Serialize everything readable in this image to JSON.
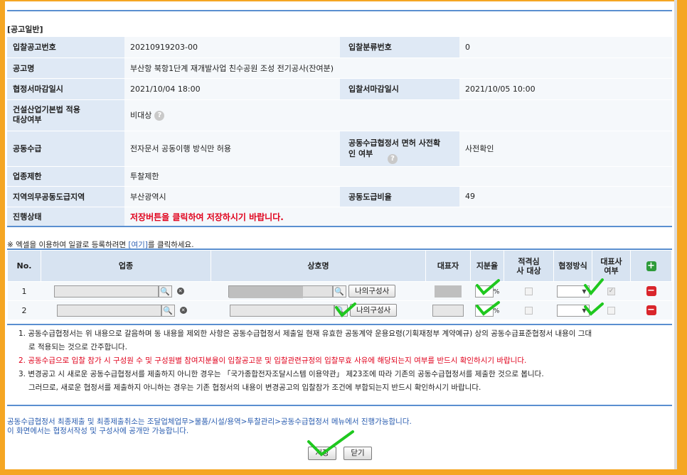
{
  "section_title": "[공고일반]",
  "info": {
    "bid_no_label": "입찰공고번호",
    "bid_no": "20210919203-00",
    "bid_class_label": "입찰분류번호",
    "bid_class": "0",
    "notice_name_label": "공고명",
    "notice_name": "부산항 북항1단계 재개발사업 친수공원 조성 전기공사(잔여분)",
    "agreement_deadline_label": "협정서마감일시",
    "agreement_deadline": "2021/10/04 18:00",
    "bid_deadline_label": "입찰서마감일시",
    "bid_deadline": "2021/10/05 10:00",
    "construction_law_label": "건설산업기본법 적용대상여부",
    "construction_law": "비대상",
    "joint_label": "공동수급",
    "joint": "전자문서 공동이행 방식만 허용",
    "exemption_label": "공동수급협정서 면허 사전확인 여부",
    "exemption": "사전확인",
    "industry_limit_label": "업종제한",
    "industry_limit": "투찰제한",
    "region_label": "지역의무공동도급지역",
    "region": "부산광역시",
    "joint_ratio_label": "공동도급비율",
    "joint_ratio": "49",
    "status_label": "진행상태",
    "status": "저장버튼을 클릭하여 저장하시기 바랍니다."
  },
  "excel_note": {
    "prefix": "※ 엑셀을 이용하여 일괄로 등록하려면 ",
    "link": "[여기]",
    "suffix": "를 클릭하세요."
  },
  "grid": {
    "headers": {
      "no": "No.",
      "industry": "업종",
      "company": "상호명",
      "rep": "대표자",
      "share": "지분율",
      "review": "적격심사 대상",
      "method": "협정방식",
      "leader": "대표사 여부"
    },
    "my_company_label": "나의구성사",
    "percent": "%",
    "rows": [
      {
        "no": "1"
      },
      {
        "no": "2"
      }
    ]
  },
  "notes": [
    "1. 공동수급협정서는 위 내용으로 갈음하며 동 내용을 제외한 사항은 공동수급협정서 제출일 현재 유효한 공동계약 운용요령(기획재정부 계약예규) 상의 공동수급표준협정서 내용이 그대",
    "로 적용되는 것으로 간주합니다.",
    "2. 공동수급으로 입찰 참가 시 구성원 수 및 구성원별 참여지분율이 입찰공고문 및 입찰관련규정의 입찰무효 사유에 해당되는지 여부를 반드시 확인하시기 바랍니다.",
    "3. 변경공고 시 새로운 공동수급협정서를 제출하지 아니한 경우는 「국가종합전자조달시스템 이용약관」 제23조에 따라 기존의 공동수급협정서를 제출한 것으로 봅니다.",
    "그러므로, 새로운 협정서를 제출하지 아니하는 경우는 기존 협정서의 내용이 변경공고의 입찰참가 조건에 부합되는지 반드시 확인하시기 바랍니다."
  ],
  "bottom_note": [
    "공동수급협정서 최종제출 및 최종제출취소는 조달업체업무>물품/시설/용역>투찰관리>공동수급협정서 메뉴에서 진행가능합니다.",
    "이 화면에서는 협정서작성 및 구성사에 공개만 가능합니다."
  ],
  "buttons": {
    "save": "저장",
    "close": "닫기"
  },
  "colors": {
    "accent": "#f5a623",
    "header_bg": "#dfe9f5",
    "link": "#2a5db0",
    "status": "#e0001b",
    "tick": "#1fc81f"
  }
}
